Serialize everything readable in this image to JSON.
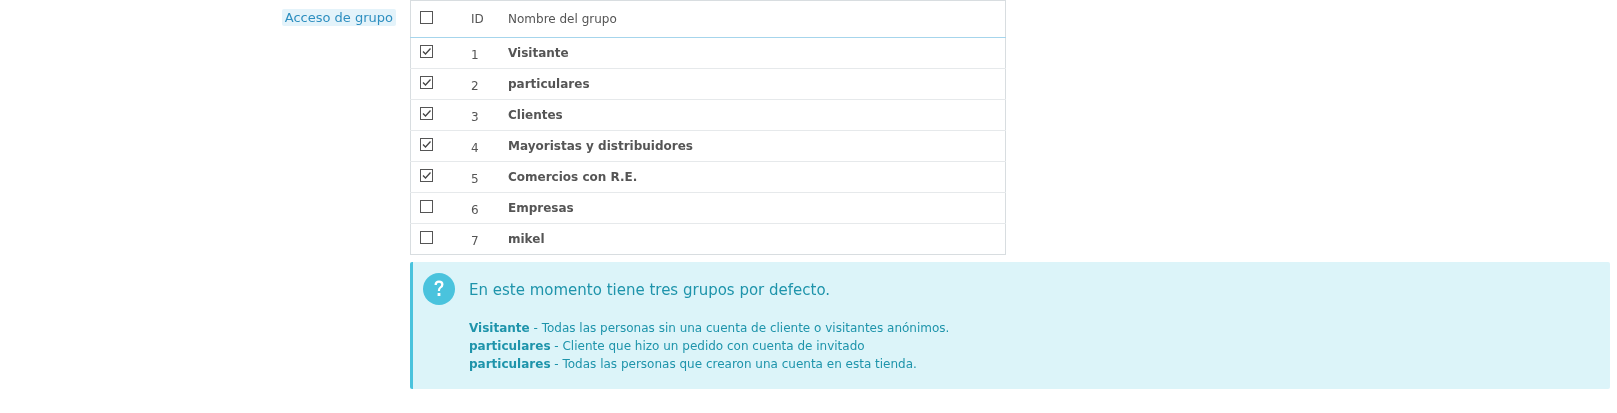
{
  "field_label": "Acceso de grupo",
  "table": {
    "header_checked": false,
    "columns": [
      "ID",
      "Nombre del grupo"
    ],
    "rows": [
      {
        "checked": true,
        "id": "1",
        "name": "Visitante"
      },
      {
        "checked": true,
        "id": "2",
        "name": "particulares"
      },
      {
        "checked": true,
        "id": "3",
        "name": "Clientes"
      },
      {
        "checked": true,
        "id": "4",
        "name": "Mayoristas y distribuidores"
      },
      {
        "checked": true,
        "id": "5",
        "name": "Comercios con R.E."
      },
      {
        "checked": false,
        "id": "6",
        "name": "Empresas"
      },
      {
        "checked": false,
        "id": "7",
        "name": "mikel"
      }
    ]
  },
  "help": {
    "title": "En este momento tiene tres grupos por defecto.",
    "lines": [
      "**Visitante** - Todas las personas sin una cuenta de cliente o visitantes anónimos.",
      "**particulares** - Cliente que hizo un pedido con cuenta de invitado",
      "**particulares** - Todas las personas que crearon una cuenta en esta tienda."
    ]
  }
}
